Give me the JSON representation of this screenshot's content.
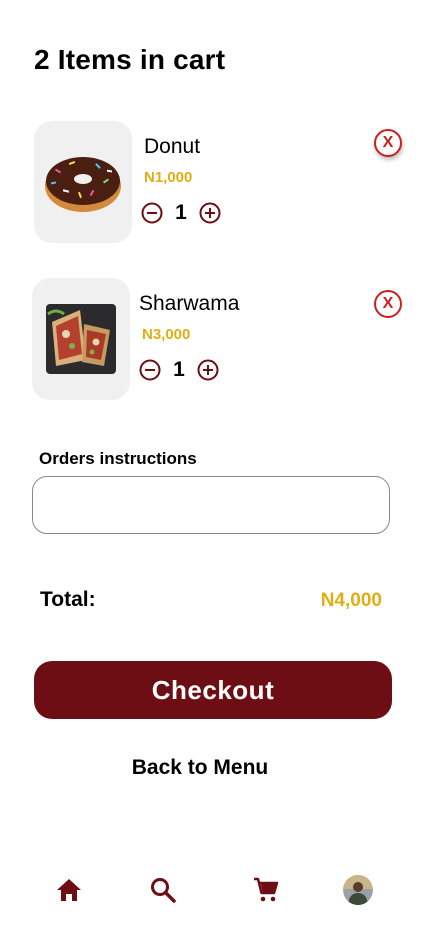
{
  "header": {
    "title": "2 Items in cart"
  },
  "cart": {
    "items": [
      {
        "name": "Donut",
        "price": "N1,000",
        "quantity": "1",
        "remove_label": "X",
        "image": "donut-image"
      },
      {
        "name": "Sharwama",
        "price": "N3,000",
        "quantity": "1",
        "remove_label": "X",
        "image": "sharwama-image"
      }
    ]
  },
  "instructions": {
    "label": "Orders instructions",
    "value": "",
    "placeholder": ""
  },
  "total": {
    "label": "Total:",
    "value": "N4,000"
  },
  "actions": {
    "checkout_label": "Checkout",
    "back_label": "Back to Menu"
  },
  "nav": {
    "items": [
      "home-icon",
      "search-icon",
      "cart-icon",
      "profile-avatar"
    ]
  },
  "colors": {
    "brand": "#6c0e13",
    "accent_price": "#e0ae12",
    "remove_red": "#cc1f1f",
    "thumb_bg": "#f0f0f0"
  }
}
